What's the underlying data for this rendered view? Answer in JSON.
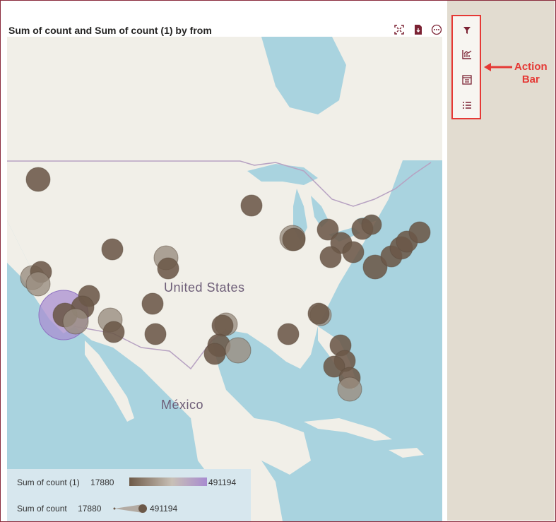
{
  "visual": {
    "title": "Sum of count and Sum of count (1) by from",
    "header_icons": [
      "focus-mode-icon",
      "export-icon",
      "more-options-icon"
    ]
  },
  "map": {
    "labels": [
      "United States",
      "México"
    ]
  },
  "legend": {
    "color_label": "Sum of count (1)",
    "color_min": "17880",
    "color_max": "491194",
    "color_scale": [
      "#6e5a48",
      "#c8c0b6",
      "#a88bd0"
    ],
    "size_label": "Sum of count",
    "size_min": "17880",
    "size_max": "491194"
  },
  "action_bar": {
    "icons": [
      "filter-icon",
      "analytics-icon",
      "format-icon",
      "list-icon"
    ]
  },
  "annotation": {
    "line1": "Action",
    "line2": "Bar",
    "color": "#e53935"
  },
  "colors": {
    "bubble": "#6b5848",
    "bubble_light": "#9a8d80",
    "bubble_highlight": "#a98fd1",
    "accent": "#7b2233"
  }
}
